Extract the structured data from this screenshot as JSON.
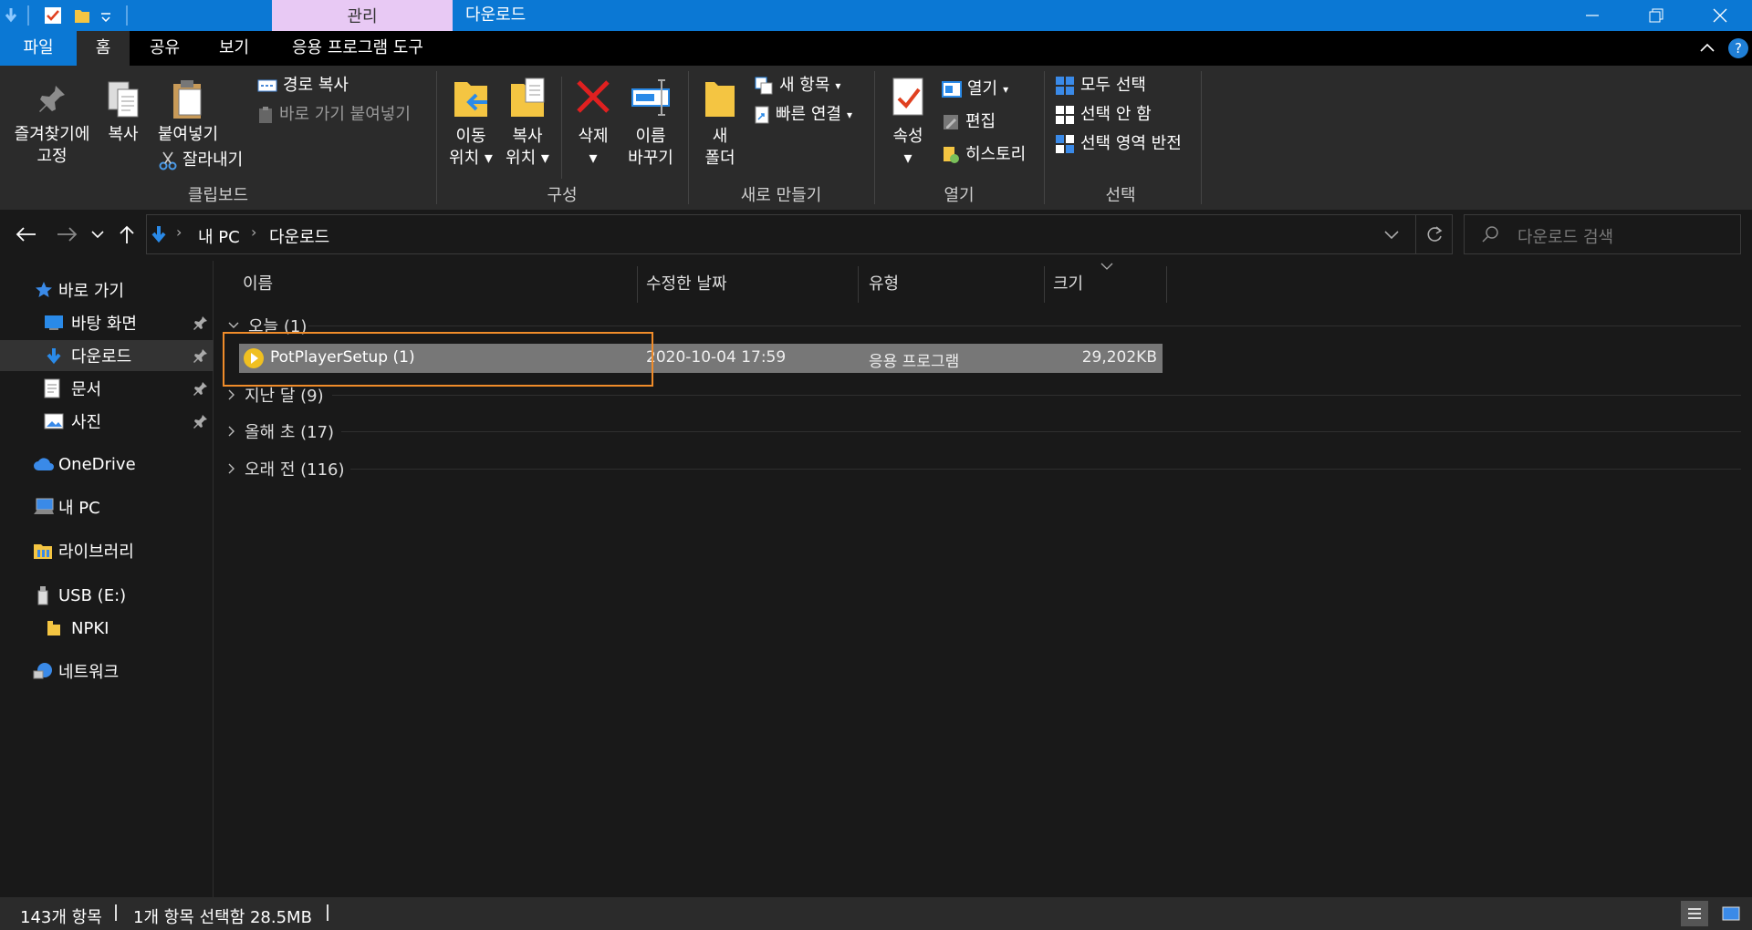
{
  "titlebar": {
    "manage_tab": "관리",
    "title": "다운로드",
    "colors": {
      "bar": "#0b78d4",
      "manage": "#e8c9f4"
    }
  },
  "ribbon_tabs": [
    "파일",
    "홈",
    "공유",
    "보기",
    "응용 프로그램 도구"
  ],
  "ribbon": {
    "clipboard": {
      "pin_line1": "즐겨찾기에",
      "pin_line2": "고정",
      "copy": "복사",
      "paste": "붙여넣기",
      "copy_path": "경로 복사",
      "paste_shortcut": "바로 가기 붙여넣기",
      "cut": "잘라내기",
      "label": "클립보드"
    },
    "organize": {
      "move_line1": "이동",
      "move_line2": "위치",
      "copyto_line1": "복사",
      "copyto_line2": "위치",
      "delete": "삭제",
      "rename_line1": "이름",
      "rename_line2": "바꾸기",
      "label": "구성"
    },
    "new": {
      "folder_line1": "새",
      "folder_line2": "폴더",
      "new_item": "새 항목",
      "easy_access": "빠른 연결",
      "label": "새로 만들기"
    },
    "open": {
      "properties": "속성",
      "open": "열기",
      "edit": "편집",
      "history": "히스토리",
      "label": "열기"
    },
    "select": {
      "select_all": "모두 선택",
      "select_none": "선택 안 함",
      "invert": "선택 영역 반전",
      "label": "선택"
    }
  },
  "address": {
    "crumb_root": "내 PC",
    "crumb_current": "다운로드",
    "search_placeholder": "다운로드 검색"
  },
  "nav": {
    "quick_access": "바로 가기",
    "desktop": "바탕 화면",
    "downloads": "다운로드",
    "documents": "문서",
    "pictures": "사진",
    "onedrive": "OneDrive",
    "thispc": "내 PC",
    "libraries": "라이브러리",
    "usb": "USB (E:)",
    "npki": "NPKI",
    "network": "네트워크"
  },
  "columns": {
    "name": "이름",
    "modified": "수정한 날짜",
    "type": "유형",
    "size": "크기"
  },
  "groups": {
    "today": "오늘 (1)",
    "last_month": "지난 달 (9)",
    "this_year": "올해 초 (17)",
    "long_ago": "오래 전 (116)"
  },
  "file": {
    "name": "PotPlayerSetup (1)",
    "modified": "2020-10-04 17:59",
    "type": "응용 프로그램",
    "size": "29,202KB"
  },
  "status": {
    "count": "143개 항목",
    "selected": "1개 항목 선택함 28.5MB"
  }
}
